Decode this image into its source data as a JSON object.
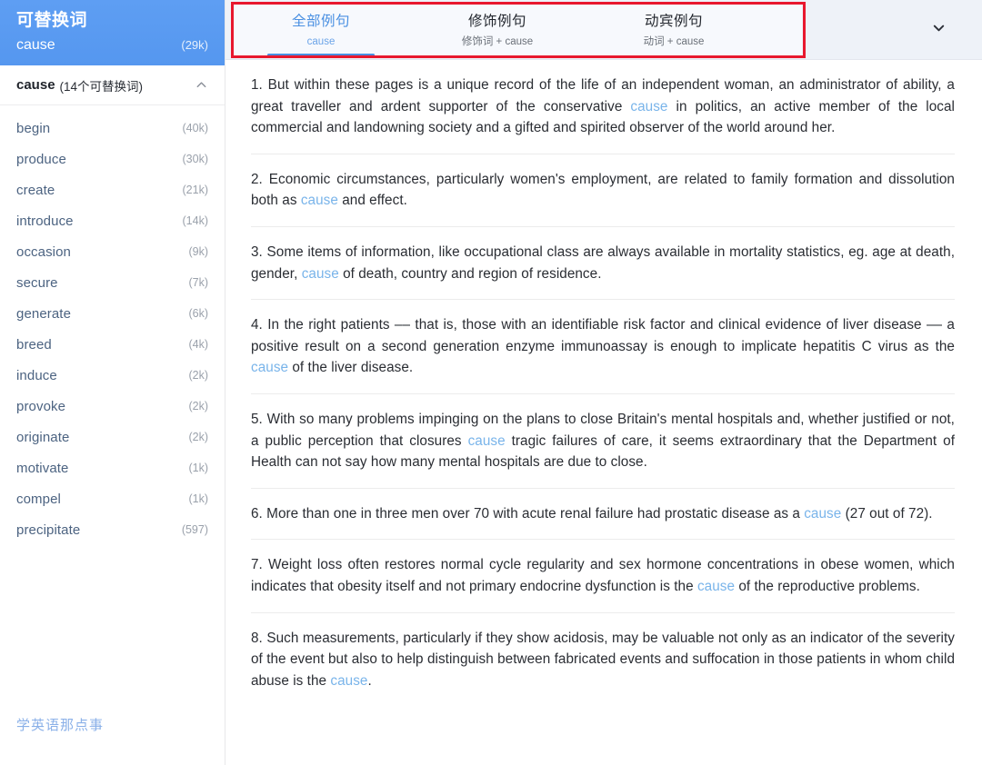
{
  "sidebar": {
    "header": {
      "title": "可替换词",
      "word": "cause",
      "count": "(29k)"
    },
    "group": {
      "word": "cause",
      "meta": "(14个可替换词)",
      "collapse_icon": "chevron-up-icon"
    },
    "items": [
      {
        "word": "begin",
        "count": "(40k)"
      },
      {
        "word": "produce",
        "count": "(30k)"
      },
      {
        "word": "create",
        "count": "(21k)"
      },
      {
        "word": "introduce",
        "count": "(14k)"
      },
      {
        "word": "occasion",
        "count": "(9k)"
      },
      {
        "word": "secure",
        "count": "(7k)"
      },
      {
        "word": "generate",
        "count": "(6k)"
      },
      {
        "word": "breed",
        "count": "(4k)"
      },
      {
        "word": "induce",
        "count": "(2k)"
      },
      {
        "word": "provoke",
        "count": "(2k)"
      },
      {
        "word": "originate",
        "count": "(2k)"
      },
      {
        "word": "motivate",
        "count": "(1k)"
      },
      {
        "word": "compel",
        "count": "(1k)"
      },
      {
        "word": "precipitate",
        "count": "(597)"
      }
    ],
    "watermark": "学英语那点事"
  },
  "main": {
    "tabs": [
      {
        "label": "全部例句",
        "sub": "cause",
        "active": true
      },
      {
        "label": "修饰例句",
        "sub": "修饰词 + cause",
        "active": false
      },
      {
        "label": "动宾例句",
        "sub": "动词 + cause",
        "active": false
      }
    ],
    "expand_icon": "chevron-down-icon",
    "highlight_box_color": "#e8182e",
    "accent_color": "#4a90e2",
    "highlight_word_color": "#79b4ea",
    "sentences": [
      {
        "number": "1.",
        "parts": [
          {
            "t": "1. But within these pages is a unique record of the life of an independent woman, an administrator of ability, a great traveller and ardent supporter of the conservative ",
            "hl": false
          },
          {
            "t": "cause",
            "hl": true
          },
          {
            "t": " in politics, an active member of the local commercial and landowning society and a gifted and spirited observer of the world around her.",
            "hl": false
          }
        ]
      },
      {
        "number": "2.",
        "parts": [
          {
            "t": "2. Economic circumstances, particularly women's employment, are related to family formation and dissolution both as ",
            "hl": false
          },
          {
            "t": "cause",
            "hl": true
          },
          {
            "t": " and effect.",
            "hl": false
          }
        ]
      },
      {
        "number": "3.",
        "parts": [
          {
            "t": "3. Some items of information, like occupational class are always available in mortality statistics, eg. age at death, gender, ",
            "hl": false
          },
          {
            "t": "cause",
            "hl": true
          },
          {
            "t": " of death, country and region of residence.",
            "hl": false
          }
        ]
      },
      {
        "number": "4.",
        "parts": [
          {
            "t": "4. In the right patients –– that is, those with an identifiable risk factor and clinical evidence of liver disease –– a positive result on a second generation enzyme immunoassay is enough to implicate hepatitis C virus as the ",
            "hl": false
          },
          {
            "t": "cause",
            "hl": true
          },
          {
            "t": " of the liver disease.",
            "hl": false
          }
        ]
      },
      {
        "number": "5.",
        "parts": [
          {
            "t": "5. With so many problems impinging on the plans to close Britain's mental hospitals and, whether justified or not, a public perception that closures ",
            "hl": false
          },
          {
            "t": "cause",
            "hl": true
          },
          {
            "t": " tragic failures of care, it seems extraordinary that the Department of Health can not say how many mental hospitals are due to close.",
            "hl": false
          }
        ]
      },
      {
        "number": "6.",
        "parts": [
          {
            "t": "6. More than one in three men over 70 with acute renal failure had prostatic disease as a ",
            "hl": false
          },
          {
            "t": "cause",
            "hl": true
          },
          {
            "t": " (27 out of 72).",
            "hl": false
          }
        ]
      },
      {
        "number": "7.",
        "parts": [
          {
            "t": "7. Weight loss often restores normal cycle regularity and sex hormone concentrations in obese women, which indicates that obesity itself and not primary endocrine dysfunction is the ",
            "hl": false
          },
          {
            "t": "cause",
            "hl": true
          },
          {
            "t": " of the reproductive problems.",
            "hl": false
          }
        ]
      },
      {
        "number": "8.",
        "parts": [
          {
            "t": "8. Such measurements, particularly if they show acidosis, may be valuable not only as an indicator of the severity of the event but also to help distinguish between fabricated events and suffocation in those patients in whom child abuse is the ",
            "hl": false
          },
          {
            "t": "cause",
            "hl": true
          },
          {
            "t": ".",
            "hl": false
          }
        ]
      }
    ]
  }
}
